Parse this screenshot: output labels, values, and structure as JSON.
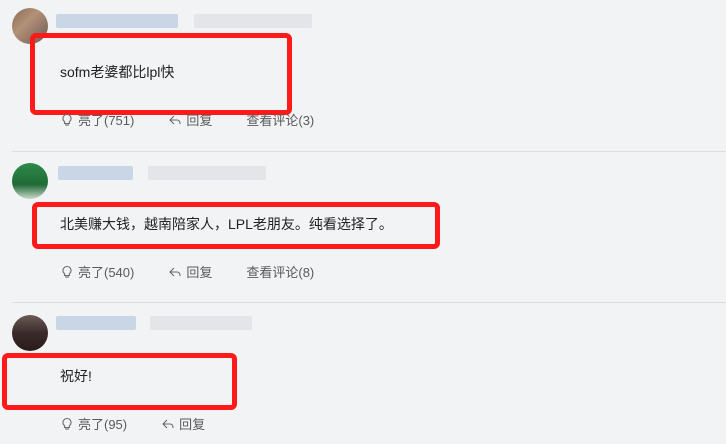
{
  "comments": [
    {
      "text": "sofm老婆都比lpl快",
      "actions": {
        "like": "亮了(751)",
        "reply": "回复",
        "view": "查看评论(3)"
      }
    },
    {
      "text": "北美赚大钱，越南陪家人，LPL老朋友。纯看选择了。",
      "actions": {
        "like": "亮了(540)",
        "reply": "回复",
        "view": "查看评论(8)"
      }
    },
    {
      "text": "祝好!",
      "actions": {
        "like": "亮了(95)",
        "reply": "回复"
      }
    }
  ],
  "colors": {
    "highlight": "#ff1a1a",
    "background": "#f2f3f5"
  },
  "icons": {
    "like": "lightbulb-icon",
    "reply": "reply-arrow-icon"
  }
}
